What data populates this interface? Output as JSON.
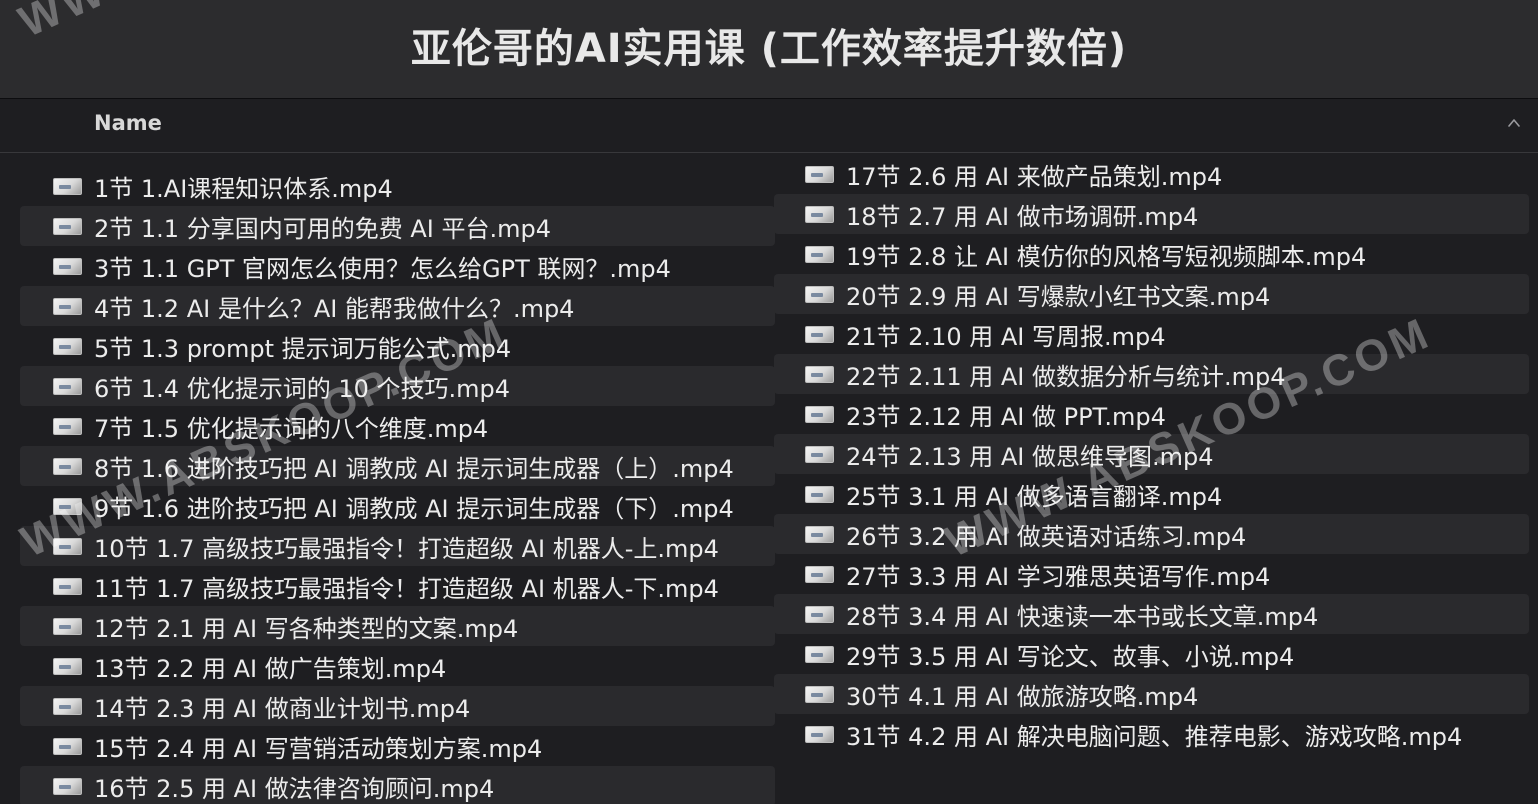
{
  "window": {
    "title": "亚伦哥的AI实用课 (工作效率提升数倍)"
  },
  "header": {
    "name_column": "Name",
    "sort_icon": "chevron-up-icon"
  },
  "files_left": [
    {
      "name": "1节 1.AI课程知识体系.mp4"
    },
    {
      "name": "2节 1.1 分享国内可用的免费 AI 平台.mp4"
    },
    {
      "name": "3节 1.1 GPT 官网怎么使用？怎么给GPT 联网？.mp4"
    },
    {
      "name": "4节 1.2 AI 是什么？AI 能帮我做什么？.mp4"
    },
    {
      "name": "5节 1.3 prompt 提示词万能公式.mp4"
    },
    {
      "name": "6节 1.4 优化提示词的 10 个技巧.mp4"
    },
    {
      "name": "7节 1.5 优化提示词的八个维度.mp4"
    },
    {
      "name": "8节 1.6 进阶技巧把 AI 调教成 AI 提示词生成器（上）.mp4"
    },
    {
      "name": "9节 1.6 进阶技巧把 AI 调教成 AI 提示词生成器（下）.mp4"
    },
    {
      "name": "10节 1.7 高级技巧最强指令！打造超级 AI 机器人-上.mp4"
    },
    {
      "name": "11节 1.7 高级技巧最强指令！打造超级 AI 机器人-下.mp4"
    },
    {
      "name": "12节 2.1 用 AI 写各种类型的文案.mp4"
    },
    {
      "name": "13节 2.2 用 AI 做广告策划.mp4"
    },
    {
      "name": "14节 2.3 用 AI 做商业计划书.mp4"
    },
    {
      "name": "15节 2.4 用 AI 写营销活动策划方案.mp4"
    },
    {
      "name": "16节 2.5 用 AI 做法律咨询顾问.mp4"
    }
  ],
  "files_right": [
    {
      "name": "17节 2.6 用 AI 来做产品策划.mp4"
    },
    {
      "name": "18节 2.7 用 AI 做市场调研.mp4"
    },
    {
      "name": "19节 2.8 让 AI 模仿你的风格写短视频脚本.mp4"
    },
    {
      "name": "20节 2.9 用 AI 写爆款小红书文案.mp4"
    },
    {
      "name": "21节 2.10 用 AI 写周报.mp4"
    },
    {
      "name": "22节 2.11 用 AI 做数据分析与统计.mp4"
    },
    {
      "name": "23节 2.12 用 AI 做 PPT.mp4"
    },
    {
      "name": "24节 2.13 用 AI 做思维导图.mp4"
    },
    {
      "name": "25节 3.1 用 AI 做多语言翻译.mp4"
    },
    {
      "name": "26节 3.2 用 AI 做英语对话练习.mp4"
    },
    {
      "name": "27节 3.3 用 AI 学习雅思英语写作.mp4"
    },
    {
      "name": "28节 3.4 用 AI 快速读一本书或长文章.mp4"
    },
    {
      "name": "29节 3.5 用 AI 写论文、故事、小说.mp4"
    },
    {
      "name": "30节 4.1 用 AI 做旅游攻略.mp4"
    },
    {
      "name": "31节 4.2 用 AI 解决电脑问题、推荐电影、游戏攻略.mp4"
    }
  ],
  "watermark": {
    "text": "WWW.ABSKOOP.COM",
    "text_top": "WWW"
  },
  "colors": {
    "titlebar": "#2c2c2e",
    "background": "#1e1e21",
    "alt_row": "#2a2a2d",
    "text": "#ececec"
  }
}
